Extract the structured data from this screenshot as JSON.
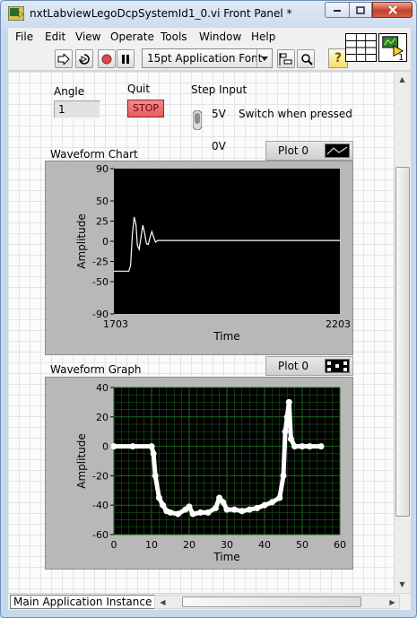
{
  "window": {
    "title": "nxtLabviewLegoDcpSystemId1_0.vi Front Panel *"
  },
  "menu": [
    "File",
    "Edit",
    "View",
    "Operate",
    "Tools",
    "Window",
    "Help"
  ],
  "toolbar": {
    "font_name": "15pt Application Font",
    "context_help": "?",
    "vi_icon_number": "1"
  },
  "controls": {
    "angle_label": "Angle",
    "angle_value": "1",
    "quit_label": "Quit",
    "stop_label": "STOP",
    "step_label": "Step Input",
    "step_on": "5V",
    "step_off": "0V",
    "switch_mode": "Switch when pressed"
  },
  "chart_data": [
    {
      "type": "line",
      "title": "Waveform Chart",
      "legend": "Plot 0",
      "xlabel": "Time",
      "ylabel": "Amplitude",
      "xlim": [
        1703,
        2203
      ],
      "ylim": [
        -90,
        90
      ],
      "xticks": [
        "1703",
        "2203"
      ],
      "yticks": [
        "90",
        "50",
        "25",
        "0",
        "-25",
        "-50",
        "-90"
      ],
      "background": "#000000",
      "line_color": "#ffffff",
      "grid": false,
      "series": [
        {
          "x": [
            1703,
            1736,
            1740,
            1744,
            1748,
            1752,
            1755,
            1759,
            1763,
            1767,
            1771,
            1775,
            1779,
            1783,
            1787,
            1791,
            1795,
            1800,
            1810,
            1830,
            1870,
            1950,
            2050,
            2203
          ],
          "values": [
            -37,
            -37,
            -30,
            10,
            30,
            20,
            -5,
            -10,
            5,
            20,
            10,
            -3,
            -4,
            5,
            12,
            5,
            -1,
            1,
            1,
            1,
            1,
            1,
            1,
            1
          ]
        }
      ]
    },
    {
      "type": "scatter",
      "title": "Waveform Graph",
      "legend": "Plot 0",
      "xlabel": "Time",
      "ylabel": "Amplitude",
      "xlim": [
        0,
        60
      ],
      "ylim": [
        -60,
        40
      ],
      "xticks": [
        "0",
        "10",
        "20",
        "30",
        "40",
        "50",
        "60"
      ],
      "yticks": [
        "40",
        "20",
        "0",
        "-20",
        "-40",
        "-60"
      ],
      "background": "#000000",
      "grid": true,
      "grid_color": "#1f6a1f",
      "point_color": "#ffffff",
      "series": [
        {
          "x": [
            0,
            5,
            10,
            10.5,
            11,
            12,
            13,
            14,
            15,
            17,
            19,
            20,
            21,
            23,
            25,
            27,
            28,
            29,
            30,
            32,
            34,
            36,
            38,
            40,
            42,
            44,
            45,
            45.5,
            46,
            46.5,
            47,
            48,
            50,
            52,
            55
          ],
          "values": [
            0,
            0,
            0,
            -5,
            -20,
            -35,
            -40,
            -44,
            -45,
            -46,
            -43,
            -41,
            -46,
            -45,
            -45,
            -42,
            -35,
            -38,
            -43,
            -43,
            -44,
            -43,
            -42,
            -40,
            -38,
            -35,
            -20,
            10,
            20,
            30,
            5,
            0,
            0,
            0,
            0
          ]
        }
      ]
    }
  ],
  "status": {
    "context": "Main Application Instance"
  }
}
